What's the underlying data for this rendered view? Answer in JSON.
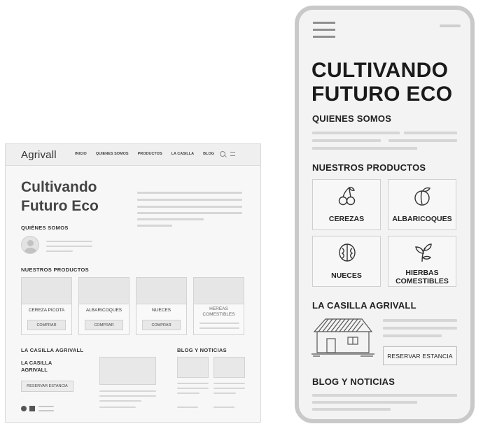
{
  "desktop": {
    "logo": "Agrivall",
    "nav": [
      "INICIO",
      "QUIENES SOMOS",
      "PRODUCTOS",
      "LA CASILLA",
      "BLOG"
    ],
    "hero_line1": "Cultivando",
    "hero_line2": "Futuro Eco",
    "about_heading": "QUIÉNES SOMOS",
    "products_heading": "NUESTROS PRODUCTOS",
    "products": [
      {
        "name": "CEREZA PICOTA",
        "button": "COMPRAR"
      },
      {
        "name": "ALBARICOQUES",
        "button": "COMPRAR"
      },
      {
        "name": "NUECES",
        "button": "COMPRAR"
      },
      {
        "name_line1": "HEREAS",
        "name_line2": "COMESTIBLES"
      }
    ],
    "casilla_heading": "LA CASILLA AGRIVALL",
    "casilla_sub": "LA CASILLA AGRIVALL",
    "reservar": "RESERVAR ESTANCIA",
    "blog_heading": "BLOG Y NOTICIAS"
  },
  "mobile": {
    "hero_line1": "CULTIVANDO",
    "hero_line2": "FUTURO ECO",
    "about_heading": "QUIENES SOMOS",
    "products_heading": "NUESTROS PRODUCTOS",
    "products": [
      {
        "name": "CEREZAS",
        "icon": "cherry-icon"
      },
      {
        "name": "ALBARICOQUES",
        "icon": "apricot-icon"
      },
      {
        "name": "NUECES",
        "icon": "walnut-icon"
      },
      {
        "name_line1": "HIERBAS",
        "name_line2": "COMESTIBLES",
        "icon": "herb-leaf-icon"
      }
    ],
    "casilla_heading": "LA CASILLA AGRIVALL",
    "reservar": "RESERVAR ESTANCIA",
    "blog_heading": "BLOG Y NOTICIAS"
  }
}
